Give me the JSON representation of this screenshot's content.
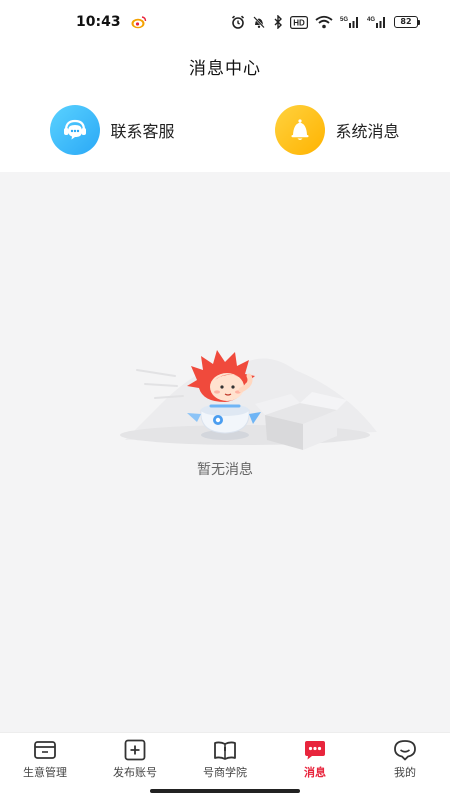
{
  "status_bar": {
    "time": "10:43",
    "battery": "82",
    "network_1": "5G",
    "network_2": "4G",
    "hd": "HD"
  },
  "header": {
    "title": "消息中心"
  },
  "shortcuts": [
    {
      "label": "联系客服",
      "icon": "headset-chat-icon",
      "color": "#2aa8f6"
    },
    {
      "label": "系统消息",
      "icon": "bell-icon",
      "color": "#ffb300"
    }
  ],
  "empty_state": {
    "text": "暂无消息"
  },
  "tabs": [
    {
      "label": "生意管理",
      "icon": "wallet-icon",
      "active": false
    },
    {
      "label": "发布账号",
      "icon": "plus-square-icon",
      "active": false
    },
    {
      "label": "号商学院",
      "icon": "book-icon",
      "active": false
    },
    {
      "label": "消息",
      "icon": "message-icon",
      "active": true
    },
    {
      "label": "我的",
      "icon": "profile-icon",
      "active": false
    }
  ],
  "colors": {
    "accent": "#e8253d",
    "background": "#f4f4f5"
  }
}
